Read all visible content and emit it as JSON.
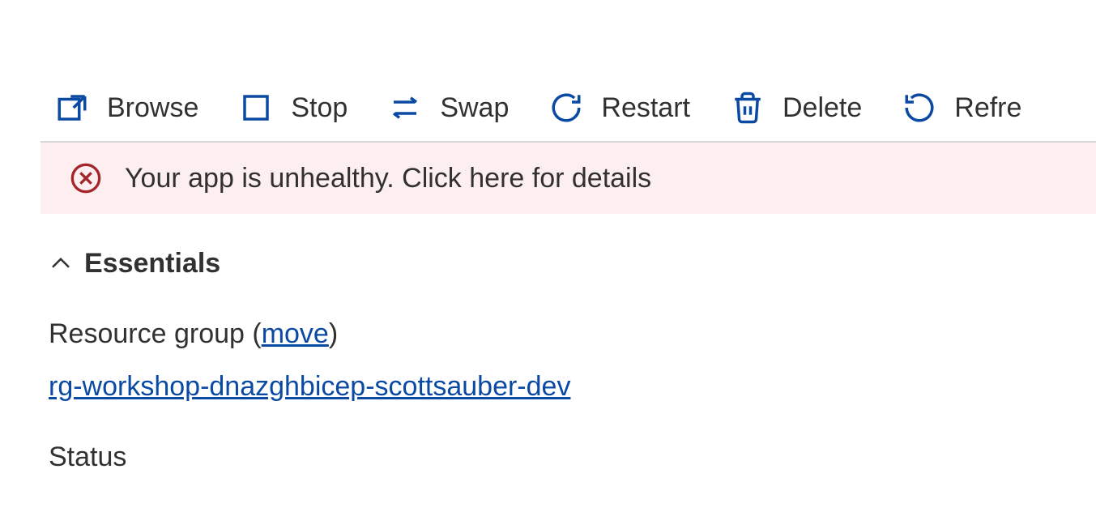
{
  "toolbar": {
    "browse_label": "Browse",
    "stop_label": "Stop",
    "swap_label": "Swap",
    "restart_label": "Restart",
    "delete_label": "Delete",
    "refresh_label": "Refre"
  },
  "banner": {
    "message": "Your app is unhealthy. Click here for details"
  },
  "essentials": {
    "title": "Essentials",
    "resource_group_label_prefix": "Resource group (",
    "resource_group_move": "move",
    "resource_group_label_suffix": ")",
    "resource_group_value": "rg-workshop-dnazghbicep-scottsauber-dev",
    "status_label": "Status"
  }
}
